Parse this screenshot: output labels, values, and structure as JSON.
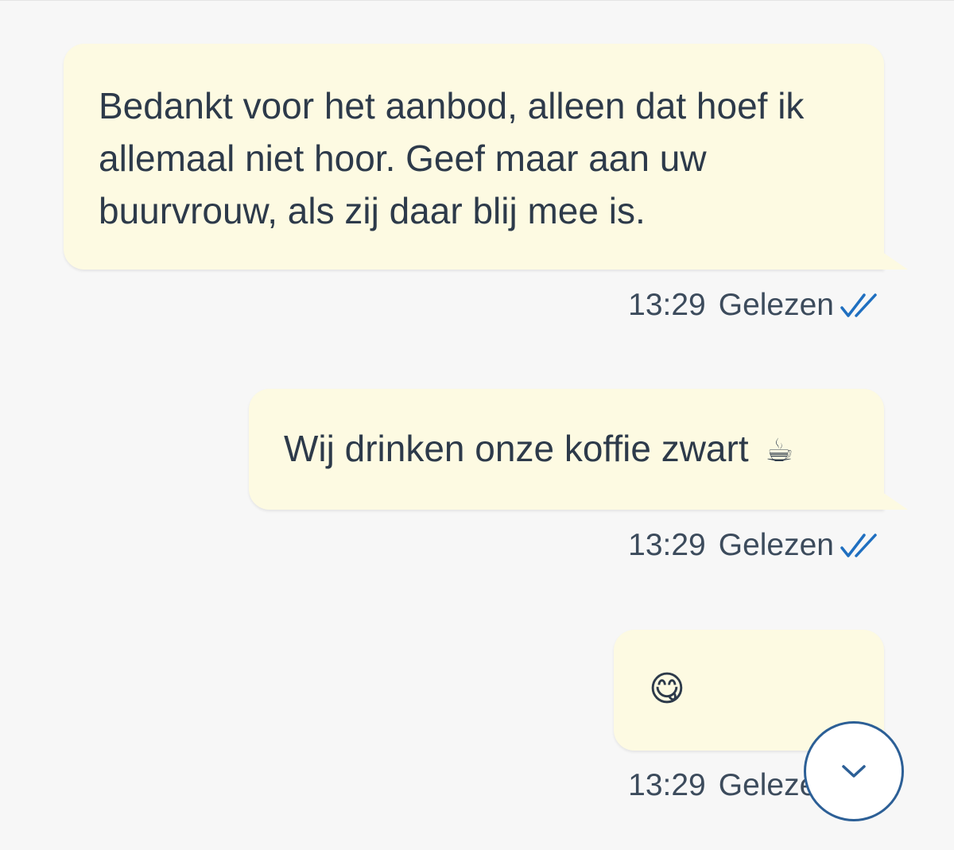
{
  "messages": [
    {
      "text": "Bedankt voor het aanbod, alleen dat hoef ik allemaal niet hoor. Geef maar aan uw buurvrouw, als zij daar blij mee is.",
      "time": "13:29",
      "status": "Gelezen",
      "status_icon": "double-check-icon"
    },
    {
      "text": "Wij drinken onze koffie zwart",
      "emoji": "☕",
      "time": "13:29",
      "status": "Gelezen",
      "status_icon": "double-check-icon"
    },
    {
      "emoji": "😋",
      "time": "13:29",
      "status": "Gelezen",
      "status_icon": "double-check-icon"
    }
  ],
  "scroll_button": {
    "icon": "chevron-down-icon"
  },
  "colors": {
    "background": "#f7f7f7",
    "bubble": "#fdfae2",
    "text": "#2d3a4a",
    "meta_text": "#3c4b5c",
    "check_blue": "#1f6fc0",
    "button_border": "#2c5f96"
  }
}
